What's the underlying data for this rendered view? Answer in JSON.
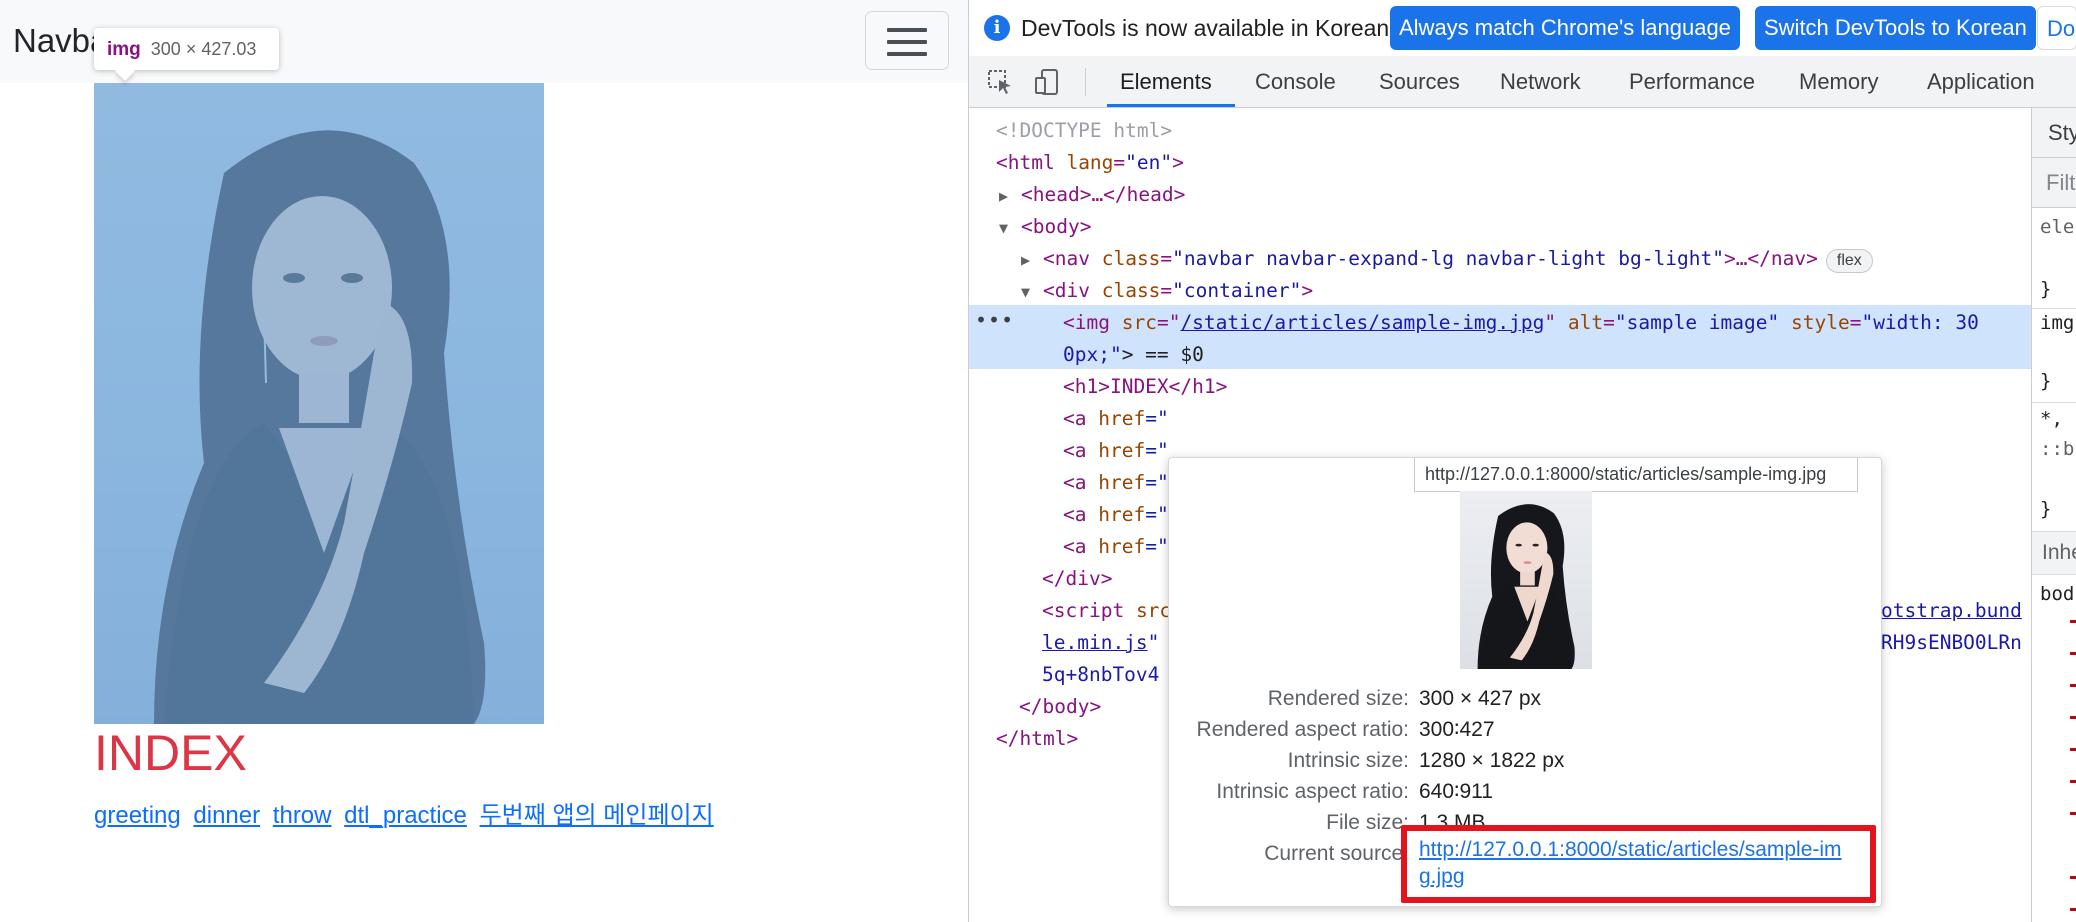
{
  "page": {
    "navbar": {
      "brand": "Navbar",
      "toggler_icon": "hamburger-icon"
    },
    "tooltip": {
      "tag": "img",
      "size": "300 × 427.03"
    },
    "image_alt": "sample image",
    "heading": "INDEX",
    "links": [
      "greeting",
      "dinner",
      "throw",
      "dtl_practice",
      "두번째 앱의 메인페이지"
    ],
    "colors": {
      "heading": "#dc3545",
      "link": "#0d6efd",
      "highlight": "#6fa8dc"
    }
  },
  "devtools": {
    "infobar": {
      "icon": "info-icon",
      "text": "DevTools is now available in Korean!",
      "btn_match": "Always match Chrome's language",
      "btn_switch": "Switch DevTools to Korean",
      "btn_dont": "Don't show again"
    },
    "toolbar": {
      "inspect_icon": "inspect-element-icon",
      "device_icon": "device-toolbar-icon"
    },
    "tabs": [
      "Elements",
      "Console",
      "Sources",
      "Network",
      "Performance",
      "Memory",
      "Application"
    ],
    "active_tab": "Elements",
    "dom": {
      "doctype": "<!DOCTYPE html>",
      "html_open_tag": "<html",
      "html_lang_attr": "lang",
      "html_lang_val": "\"en\"",
      "close_bracket": ">",
      "head": "<head>…</head>",
      "body_open": "<body>",
      "nav_open": "<nav",
      "nav_class_attr": "class",
      "nav_class_val": "\"navbar navbar-expand-lg navbar-light bg-light\"",
      "nav_close": ">…</nav>",
      "flex_badge": "flex",
      "div_open": "<div",
      "div_class_attr": "class",
      "div_class_val": "\"container\"",
      "img_open": "<img",
      "img_src_attr": "src",
      "img_src_val": "/static/articles/sample-img.jpg",
      "img_alt_attr": "alt",
      "img_alt_val": "\"sample image\"",
      "img_style_attr": "style",
      "img_style_val_1": "\"width: 30",
      "img_style_val_2": "0px;\"",
      "img_eq": "> == $0",
      "h1_line": "<h1>INDEX</h1>",
      "a_open": "<a",
      "a_href_attr": "href",
      "a_href_partial": "=\"",
      "div_close": "</div>",
      "script_open": "<script",
      "script_src_attr": "src",
      "script_src_tail_1": "otstrap.bund",
      "script_src_tail_2": "le.min.js",
      "script_integrity_tail": "RH9sENBO0LRn",
      "script_hash_line": "5q+8nbTov4",
      "body_close": "</body>",
      "html_close": "</html>",
      "row_dots": "•••"
    },
    "popover": {
      "url": "http://127.0.0.1:8000/static/articles/sample-img.jpg",
      "rendered_size_label": "Rendered size:",
      "rendered_size": "300 × 427 px",
      "rendered_aspect_label": "Rendered aspect ratio:",
      "rendered_aspect": "300∶427",
      "intrinsic_size_label": "Intrinsic size:",
      "intrinsic_size": "1280 × 1822 px",
      "intrinsic_aspect_label": "Intrinsic aspect ratio:",
      "intrinsic_aspect": "640∶911",
      "file_size_label": "File size:",
      "file_size": "1.3 MB",
      "current_source_label": "Current source:",
      "current_source": "http://127.0.0.1:8000/static/articles/sample-img.jpg",
      "highlight_color": "#e2151f"
    },
    "styles_pane": {
      "tab": "Styles",
      "filter": "Filter",
      "lines": [
        "ele",
        "}",
        "img",
        "}",
        "*,",
        "::b",
        "}",
        "bod"
      ],
      "inherited": "Inhe"
    }
  }
}
